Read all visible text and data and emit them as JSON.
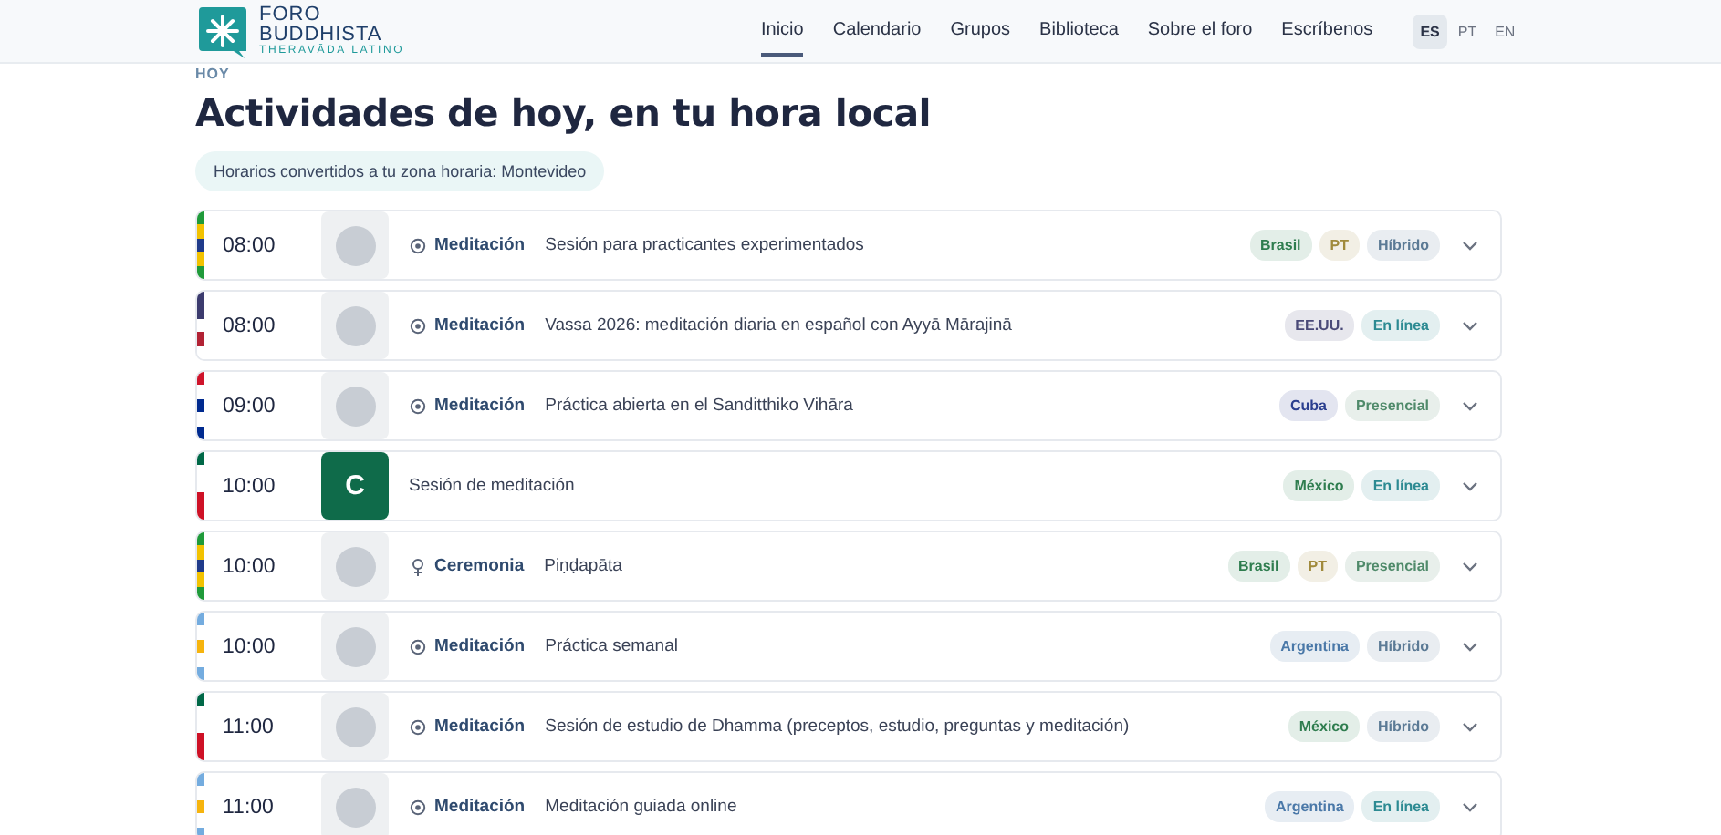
{
  "header": {
    "logo": {
      "line1": "FORO",
      "line2": "BUDDHISTA",
      "line3": "THERAVĀDA LATINO"
    },
    "nav": [
      {
        "label": "Inicio",
        "selected": true
      },
      {
        "label": "Calendario",
        "selected": false
      },
      {
        "label": "Grupos",
        "selected": false
      },
      {
        "label": "Biblioteca",
        "selected": false
      },
      {
        "label": "Sobre el foro",
        "selected": false
      },
      {
        "label": "Escríbenos",
        "selected": false
      }
    ],
    "languages": [
      {
        "label": "ES",
        "selected": true
      },
      {
        "label": "PT",
        "selected": false
      },
      {
        "label": "EN",
        "selected": false
      }
    ]
  },
  "eyebrow": "HOY",
  "title": "Actividades de hoy, en tu hora local",
  "timezone_note": "Horarios convertidos a tu zona horaria: Montevideo",
  "rows": [
    {
      "time": "08:00",
      "flag": [
        {
          "color": "#1f9a3a"
        },
        {
          "color": "#f2c200"
        },
        {
          "color": "#1f3a8a"
        },
        {
          "color": "#f2c200"
        },
        {
          "color": "#1f9a3a"
        }
      ],
      "avatar": {
        "kind": "image"
      },
      "category": {
        "kind": "meditation",
        "label": "Meditación"
      },
      "title": "Sesión para practicantes experimentados",
      "tags": [
        {
          "label": "Brasil",
          "color": "#2f7d4f"
        },
        {
          "label": "PT",
          "color": "#a08a3c"
        },
        {
          "label": "Híbrido",
          "color": "#5b7a95"
        }
      ]
    },
    {
      "time": "08:00",
      "flag": [
        {
          "color": "#3c3b6e"
        },
        {
          "color": "#3c3b6e"
        },
        {
          "color": "#ffffff"
        },
        {
          "color": "#b22234"
        },
        {
          "color": "#ffffff"
        }
      ],
      "avatar": {
        "kind": "image"
      },
      "category": {
        "kind": "meditation",
        "label": "Meditación"
      },
      "title": "Vassa 2026: meditación diaria en español con Ayyā Mārajinā",
      "tags": [
        {
          "label": "EE.UU.",
          "color": "#4a4a78"
        },
        {
          "label": "En línea",
          "color": "#2c8a92"
        }
      ]
    },
    {
      "time": "09:00",
      "flag": [
        {
          "color": "#cf142b"
        },
        {
          "color": "#ffffff"
        },
        {
          "color": "#002a8f"
        },
        {
          "color": "#ffffff"
        },
        {
          "color": "#002a8f"
        }
      ],
      "avatar": {
        "kind": "image"
      },
      "category": {
        "kind": "meditation",
        "label": "Meditación"
      },
      "title": "Práctica abierta en el Sanditthiko Vihāra",
      "tags": [
        {
          "label": "Cuba",
          "color": "#2b3f8f"
        },
        {
          "label": "Presencial",
          "color": "#4f8a6a"
        }
      ]
    },
    {
      "time": "10:00",
      "flag": [
        {
          "color": "#006847"
        },
        {
          "color": "#ffffff"
        },
        {
          "color": "#ffffff"
        },
        {
          "color": "#ce1126"
        },
        {
          "color": "#ce1126"
        }
      ],
      "avatar": {
        "kind": "letter",
        "text": "C"
      },
      "title": "Sesión de meditación",
      "tags": [
        {
          "label": "México",
          "color": "#2f7d4f"
        },
        {
          "label": "En línea",
          "color": "#2c8a92"
        }
      ]
    },
    {
      "time": "10:00",
      "flag": [
        {
          "color": "#1f9a3a"
        },
        {
          "color": "#f2c200"
        },
        {
          "color": "#1f3a8a"
        },
        {
          "color": "#f2c200"
        },
        {
          "color": "#1f9a3a"
        }
      ],
      "avatar": {
        "kind": "image"
      },
      "category": {
        "kind": "ceremony",
        "label": "Ceremonia"
      },
      "title": "Piṇḍapāta",
      "tags": [
        {
          "label": "Brasil",
          "color": "#2f7d4f"
        },
        {
          "label": "PT",
          "color": "#a08a3c"
        },
        {
          "label": "Presencial",
          "color": "#4f8a6a"
        }
      ]
    },
    {
      "time": "10:00",
      "flag": [
        {
          "color": "#74acdf"
        },
        {
          "color": "#ffffff"
        },
        {
          "color": "#f6b40e"
        },
        {
          "color": "#ffffff"
        },
        {
          "color": "#74acdf"
        }
      ],
      "avatar": {
        "kind": "image"
      },
      "category": {
        "kind": "meditation",
        "label": "Meditación"
      },
      "title": "Práctica semanal",
      "tags": [
        {
          "label": "Argentina",
          "color": "#4a78a8"
        },
        {
          "label": "Híbrido",
          "color": "#5b7a95"
        }
      ]
    },
    {
      "time": "11:00",
      "flag": [
        {
          "color": "#006847"
        },
        {
          "color": "#ffffff"
        },
        {
          "color": "#ffffff"
        },
        {
          "color": "#ce1126"
        },
        {
          "color": "#ce1126"
        }
      ],
      "avatar": {
        "kind": "image"
      },
      "category": {
        "kind": "meditation",
        "label": "Meditación"
      },
      "title": "Sesión de estudio de Dhamma (preceptos, estudio, preguntas y meditación)",
      "tags": [
        {
          "label": "México",
          "color": "#2f7d4f"
        },
        {
          "label": "Híbrido",
          "color": "#5b7a95"
        }
      ]
    },
    {
      "time": "11:00",
      "flag": [
        {
          "color": "#74acdf"
        },
        {
          "color": "#ffffff"
        },
        {
          "color": "#f6b40e"
        },
        {
          "color": "#ffffff"
        },
        {
          "color": "#74acdf"
        }
      ],
      "avatar": {
        "kind": "image"
      },
      "category": {
        "kind": "meditation",
        "label": "Meditación"
      },
      "title": "Meditación guiada online",
      "tags": [
        {
          "label": "Argentina",
          "color": "#4a78a8"
        },
        {
          "label": "En línea",
          "color": "#2c8a92"
        }
      ]
    }
  ]
}
